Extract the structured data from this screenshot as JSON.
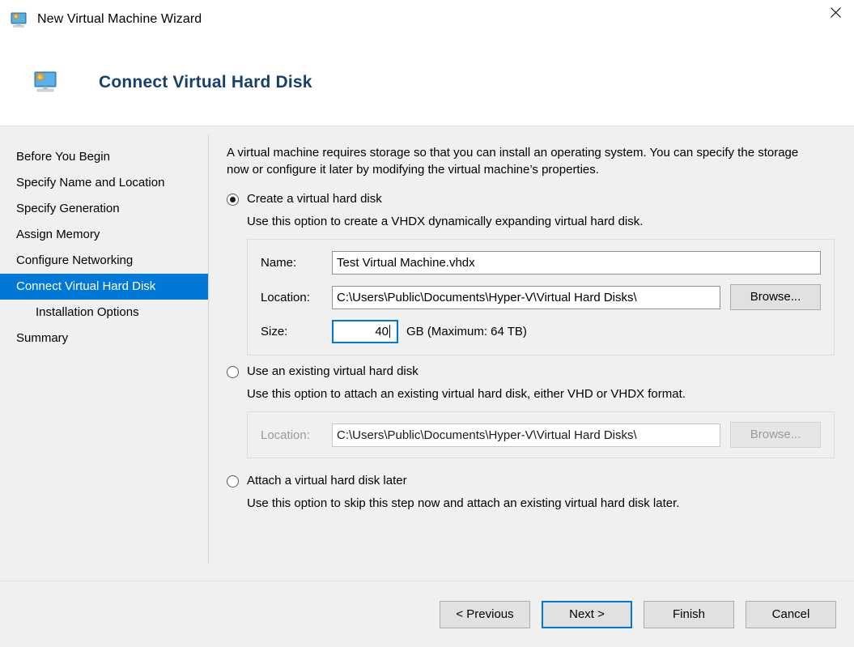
{
  "window": {
    "title": "New Virtual Machine Wizard",
    "icon": "virtual-machine-icon",
    "close_icon": "close-icon"
  },
  "header": {
    "icon": "virtual-machine-icon",
    "title": "Connect Virtual Hard Disk",
    "title_color": "#17406d"
  },
  "sidebar": {
    "active_color": "#0078d7",
    "items": [
      {
        "label": "Before You Begin",
        "active": false,
        "indent": false
      },
      {
        "label": "Specify Name and Location",
        "active": false,
        "indent": false
      },
      {
        "label": "Specify Generation",
        "active": false,
        "indent": false
      },
      {
        "label": "Assign Memory",
        "active": false,
        "indent": false
      },
      {
        "label": "Configure Networking",
        "active": false,
        "indent": false
      },
      {
        "label": "Connect Virtual Hard Disk",
        "active": true,
        "indent": false
      },
      {
        "label": "Installation Options",
        "active": false,
        "indent": true
      },
      {
        "label": "Summary",
        "active": false,
        "indent": false
      }
    ]
  },
  "content": {
    "intro": "A virtual machine requires storage so that you can install an operating system. You can specify the storage now or configure it later by modifying the virtual machine’s properties.",
    "options": [
      {
        "label": "Create a virtual hard disk",
        "selected": true,
        "description": "Use this option to create a VHDX dynamically expanding virtual hard disk."
      },
      {
        "label": "Use an existing virtual hard disk",
        "selected": false,
        "description": "Use this option to attach an existing virtual hard disk, either VHD or VHDX format."
      },
      {
        "label": "Attach a virtual hard disk later",
        "selected": false,
        "description": "Use this option to skip this step now and attach an existing virtual hard disk later."
      }
    ],
    "create_group": {
      "name_label": "Name:",
      "name_value": "Test Virtual Machine.vhdx",
      "location_label": "Location:",
      "location_value": "C:\\Users\\Public\\Documents\\Hyper-V\\Virtual Hard Disks\\",
      "browse_label": "Browse...",
      "size_label": "Size:",
      "size_value": "40",
      "size_suffix": "GB (Maximum: 64 TB)"
    },
    "existing_group": {
      "location_label": "Location:",
      "location_value": "C:\\Users\\Public\\Documents\\Hyper-V\\Virtual Hard Disks\\",
      "browse_label": "Browse..."
    }
  },
  "footer": {
    "previous_label": "< Previous",
    "next_label": "Next >",
    "finish_label": "Finish",
    "cancel_label": "Cancel",
    "default_button": "Next >",
    "focus_color": "#0078d7"
  }
}
